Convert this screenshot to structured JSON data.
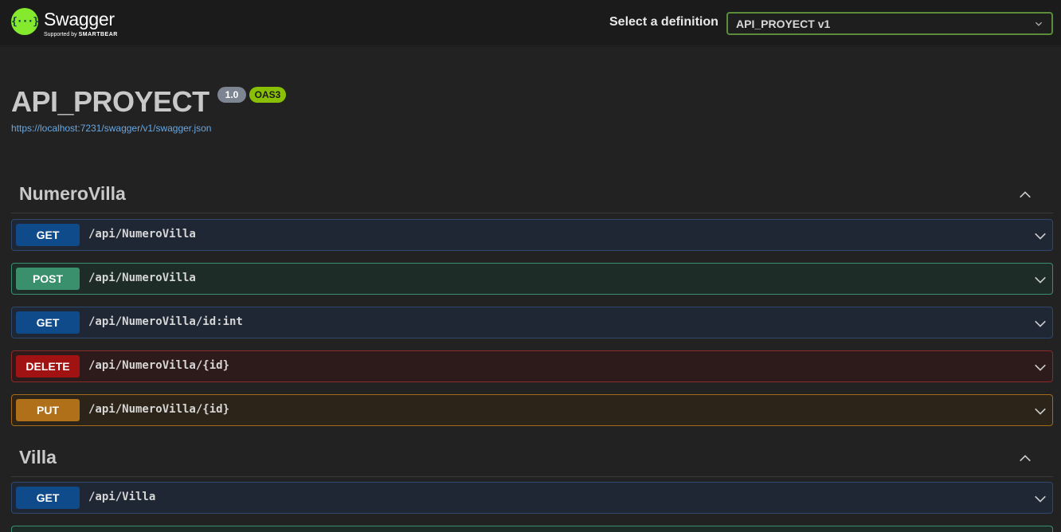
{
  "topbar": {
    "logo_icon": "{···}",
    "logo_name": "Swagger",
    "logo_sub_prefix": "Supported by",
    "logo_sub_brand": "SMARTBEAR",
    "definition_label": "Select a definition",
    "definition_value": "API_PROYECT v1"
  },
  "info": {
    "title": "API_PROYECT",
    "version": "1.0",
    "oas": "OAS3",
    "spec_url": "https://localhost:7231/swagger/v1/swagger.json"
  },
  "tags": [
    {
      "name": "NumeroVilla",
      "operations": [
        {
          "method": "GET",
          "path": "/api/NumeroVilla"
        },
        {
          "method": "POST",
          "path": "/api/NumeroVilla"
        },
        {
          "method": "GET",
          "path": "/api/NumeroVilla/id:int"
        },
        {
          "method": "DELETE",
          "path": "/api/NumeroVilla/{id}"
        },
        {
          "method": "PUT",
          "path": "/api/NumeroVilla/{id}"
        }
      ]
    },
    {
      "name": "Villa",
      "operations": [
        {
          "method": "GET",
          "path": "/api/Villa"
        }
      ]
    }
  ],
  "icons": {
    "collapse": "chevron-up-icon",
    "expand": "chevron-down-icon"
  },
  "colors": {
    "get": "#0f4b8a",
    "post": "#3a8f6c",
    "delete": "#a11313",
    "put": "#b0701a",
    "brand": "#85ea2d"
  }
}
